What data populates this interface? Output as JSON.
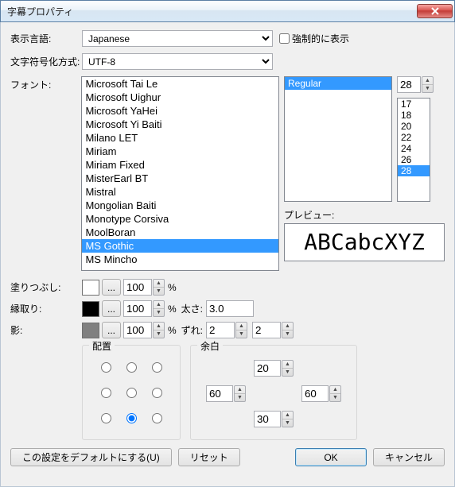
{
  "window": {
    "title": "字幕プロパティ"
  },
  "labels": {
    "language": "表示言語:",
    "encoding": "文字符号化方式:",
    "font": "フォント:",
    "preview": "プレビュー:",
    "fill": "塗りつぶし:",
    "outline": "縁取り:",
    "shadow": "影:",
    "thickness": "太さ:",
    "offset": "ずれ:",
    "alignment": "配置",
    "margins": "余白",
    "pct": "%"
  },
  "language": {
    "value": "Japanese"
  },
  "force_show": {
    "label": "強制的に表示",
    "checked": false
  },
  "encoding": {
    "value": "UTF-8"
  },
  "fonts": [
    "Microsoft Tai Le",
    "Microsoft Uighur",
    "Microsoft YaHei",
    "Microsoft Yi Baiti",
    "Milano LET",
    "Miriam",
    "Miriam Fixed",
    "MisterEarl BT",
    "Mistral",
    "Mongolian Baiti",
    "Monotype Corsiva",
    "MoolBoran",
    "MS Gothic",
    "MS Mincho"
  ],
  "font_selected": "MS Gothic",
  "styles": [
    "Regular"
  ],
  "style_selected": "Regular",
  "size_value": "28",
  "sizes": [
    "17",
    "18",
    "20",
    "22",
    "24",
    "26",
    "28"
  ],
  "size_selected": "28",
  "preview_text": "ABCabcXYZ",
  "fill": {
    "color": "#ffffff",
    "opacity": "100"
  },
  "outline": {
    "color": "#000000",
    "opacity": "100",
    "thickness": "3.0"
  },
  "shadow": {
    "color": "#808080",
    "opacity": "100",
    "offx": "2",
    "offy": "2"
  },
  "alignment_selected": 7,
  "margins": {
    "top": "20",
    "left": "60",
    "right": "60",
    "bottom": "30"
  },
  "buttons": {
    "set_default": "この設定をデフォルトにする(U)",
    "reset": "リセット",
    "ok": "OK",
    "cancel": "キャンセル"
  },
  "picker": "..."
}
